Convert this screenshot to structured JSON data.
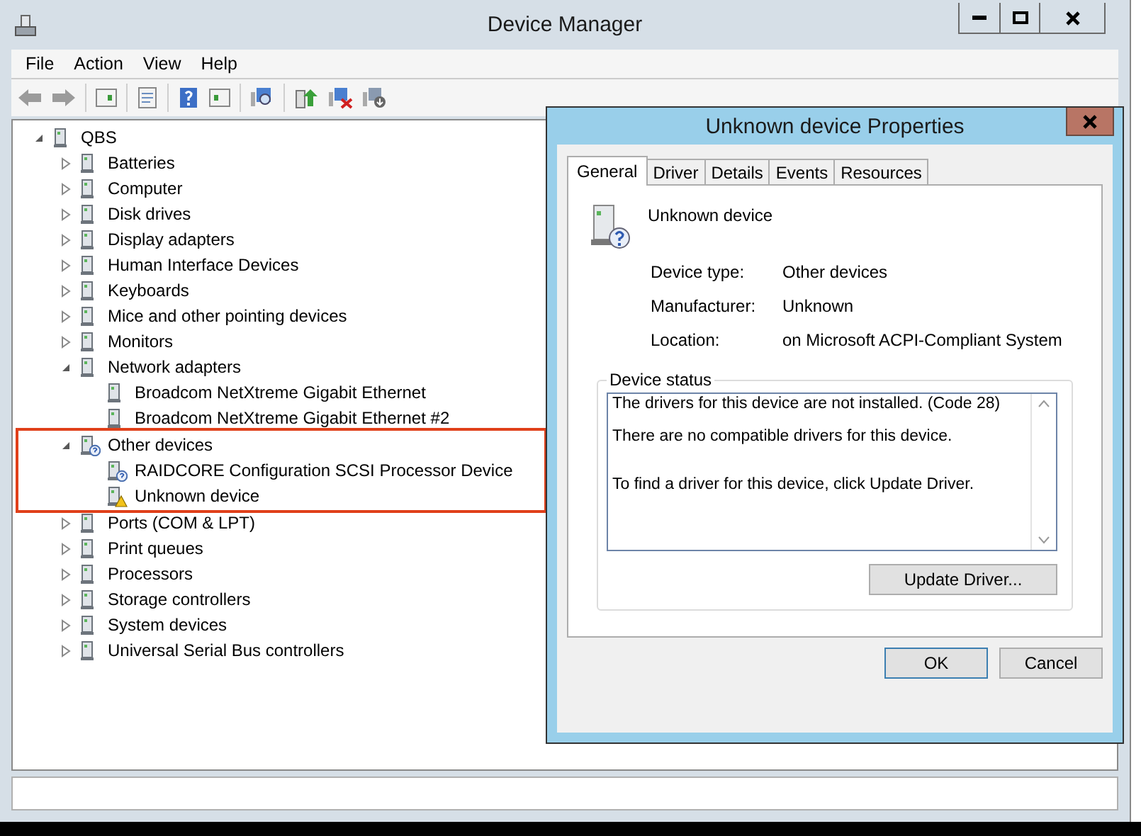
{
  "window": {
    "title": "Device Manager"
  },
  "menu": [
    "File",
    "Action",
    "View",
    "Help"
  ],
  "tree": [
    {
      "label": "QBS",
      "expanded": true,
      "children": [
        {
          "label": "Batteries",
          "expanded": false
        },
        {
          "label": "Computer",
          "expanded": false
        },
        {
          "label": "Disk drives",
          "expanded": false
        },
        {
          "label": "Display adapters",
          "expanded": false
        },
        {
          "label": "Human Interface Devices",
          "expanded": false
        },
        {
          "label": "Keyboards",
          "expanded": false
        },
        {
          "label": "Mice and other pointing devices",
          "expanded": false
        },
        {
          "label": "Monitors",
          "expanded": false
        },
        {
          "label": "Network adapters",
          "expanded": true,
          "children": [
            {
              "label": "Broadcom NetXtreme Gigabit Ethernet"
            },
            {
              "label": "Broadcom NetXtreme Gigabit Ethernet #2"
            }
          ]
        },
        {
          "label": "Other devices",
          "expanded": true,
          "highlighted": true,
          "kind": "unknown",
          "children": [
            {
              "label": "RAIDCORE Configuration SCSI Processor Device",
              "kind": "unknown"
            },
            {
              "label": "Unknown device",
              "kind": "warning"
            }
          ]
        },
        {
          "label": "Ports (COM & LPT)",
          "expanded": false
        },
        {
          "label": "Print queues",
          "expanded": false
        },
        {
          "label": "Processors",
          "expanded": false
        },
        {
          "label": "Storage controllers",
          "expanded": false
        },
        {
          "label": "System devices",
          "expanded": false
        },
        {
          "label": "Universal Serial Bus controllers",
          "expanded": false
        }
      ]
    }
  ],
  "dialog": {
    "title": "Unknown device Properties",
    "tabs": [
      {
        "label": "General",
        "selected": true
      },
      {
        "label": "Driver",
        "selected": false
      },
      {
        "label": "Details",
        "selected": false
      },
      {
        "label": "Events",
        "selected": false
      },
      {
        "label": "Resources",
        "selected": false
      }
    ],
    "device_name": "Unknown device",
    "properties": [
      {
        "label": "Device type:",
        "value": "Other devices"
      },
      {
        "label": "Manufacturer:",
        "value": "Unknown"
      },
      {
        "label": "Location:",
        "value": "on Microsoft ACPI-Compliant System"
      }
    ],
    "status_group": {
      "title": "Device status",
      "lines": [
        "The drivers for this device are not installed. (Code 28)",
        "There are no compatible drivers for this device.",
        "To find a driver for this device, click Update Driver."
      ],
      "button": "Update Driver..."
    },
    "buttons": [
      {
        "label": "OK",
        "default": true
      },
      {
        "label": "Cancel",
        "default": false
      }
    ]
  }
}
